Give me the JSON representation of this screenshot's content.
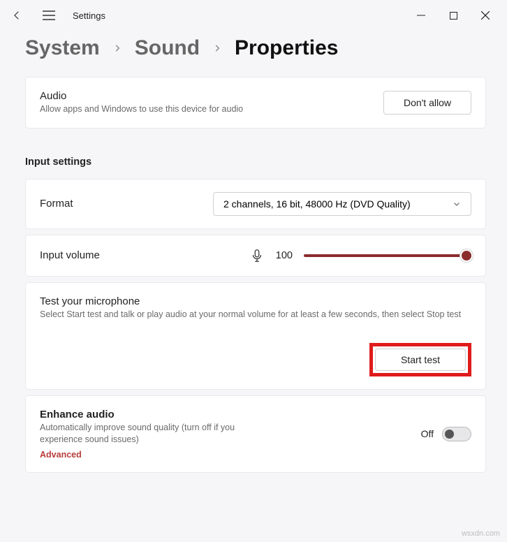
{
  "app": {
    "title": "Settings"
  },
  "breadcrumb": {
    "system": "System",
    "sound": "Sound",
    "properties": "Properties"
  },
  "audio_card": {
    "title": "Audio",
    "desc": "Allow apps and Windows to use this device for audio",
    "button": "Don't allow"
  },
  "section": {
    "input_settings": "Input settings"
  },
  "format": {
    "label": "Format",
    "value": "2 channels, 16 bit, 48000 Hz (DVD Quality)"
  },
  "volume": {
    "label": "Input volume",
    "value": "100"
  },
  "test": {
    "title": "Test your microphone",
    "desc": "Select Start test and talk or play audio at your normal volume for at least a few seconds, then select Stop test",
    "button": "Start test"
  },
  "enhance": {
    "title": "Enhance audio",
    "desc": "Automatically improve sound quality (turn off if you experience sound issues)",
    "advanced": "Advanced",
    "toggle_label": "Off"
  },
  "watermark": "wsxdn.com"
}
